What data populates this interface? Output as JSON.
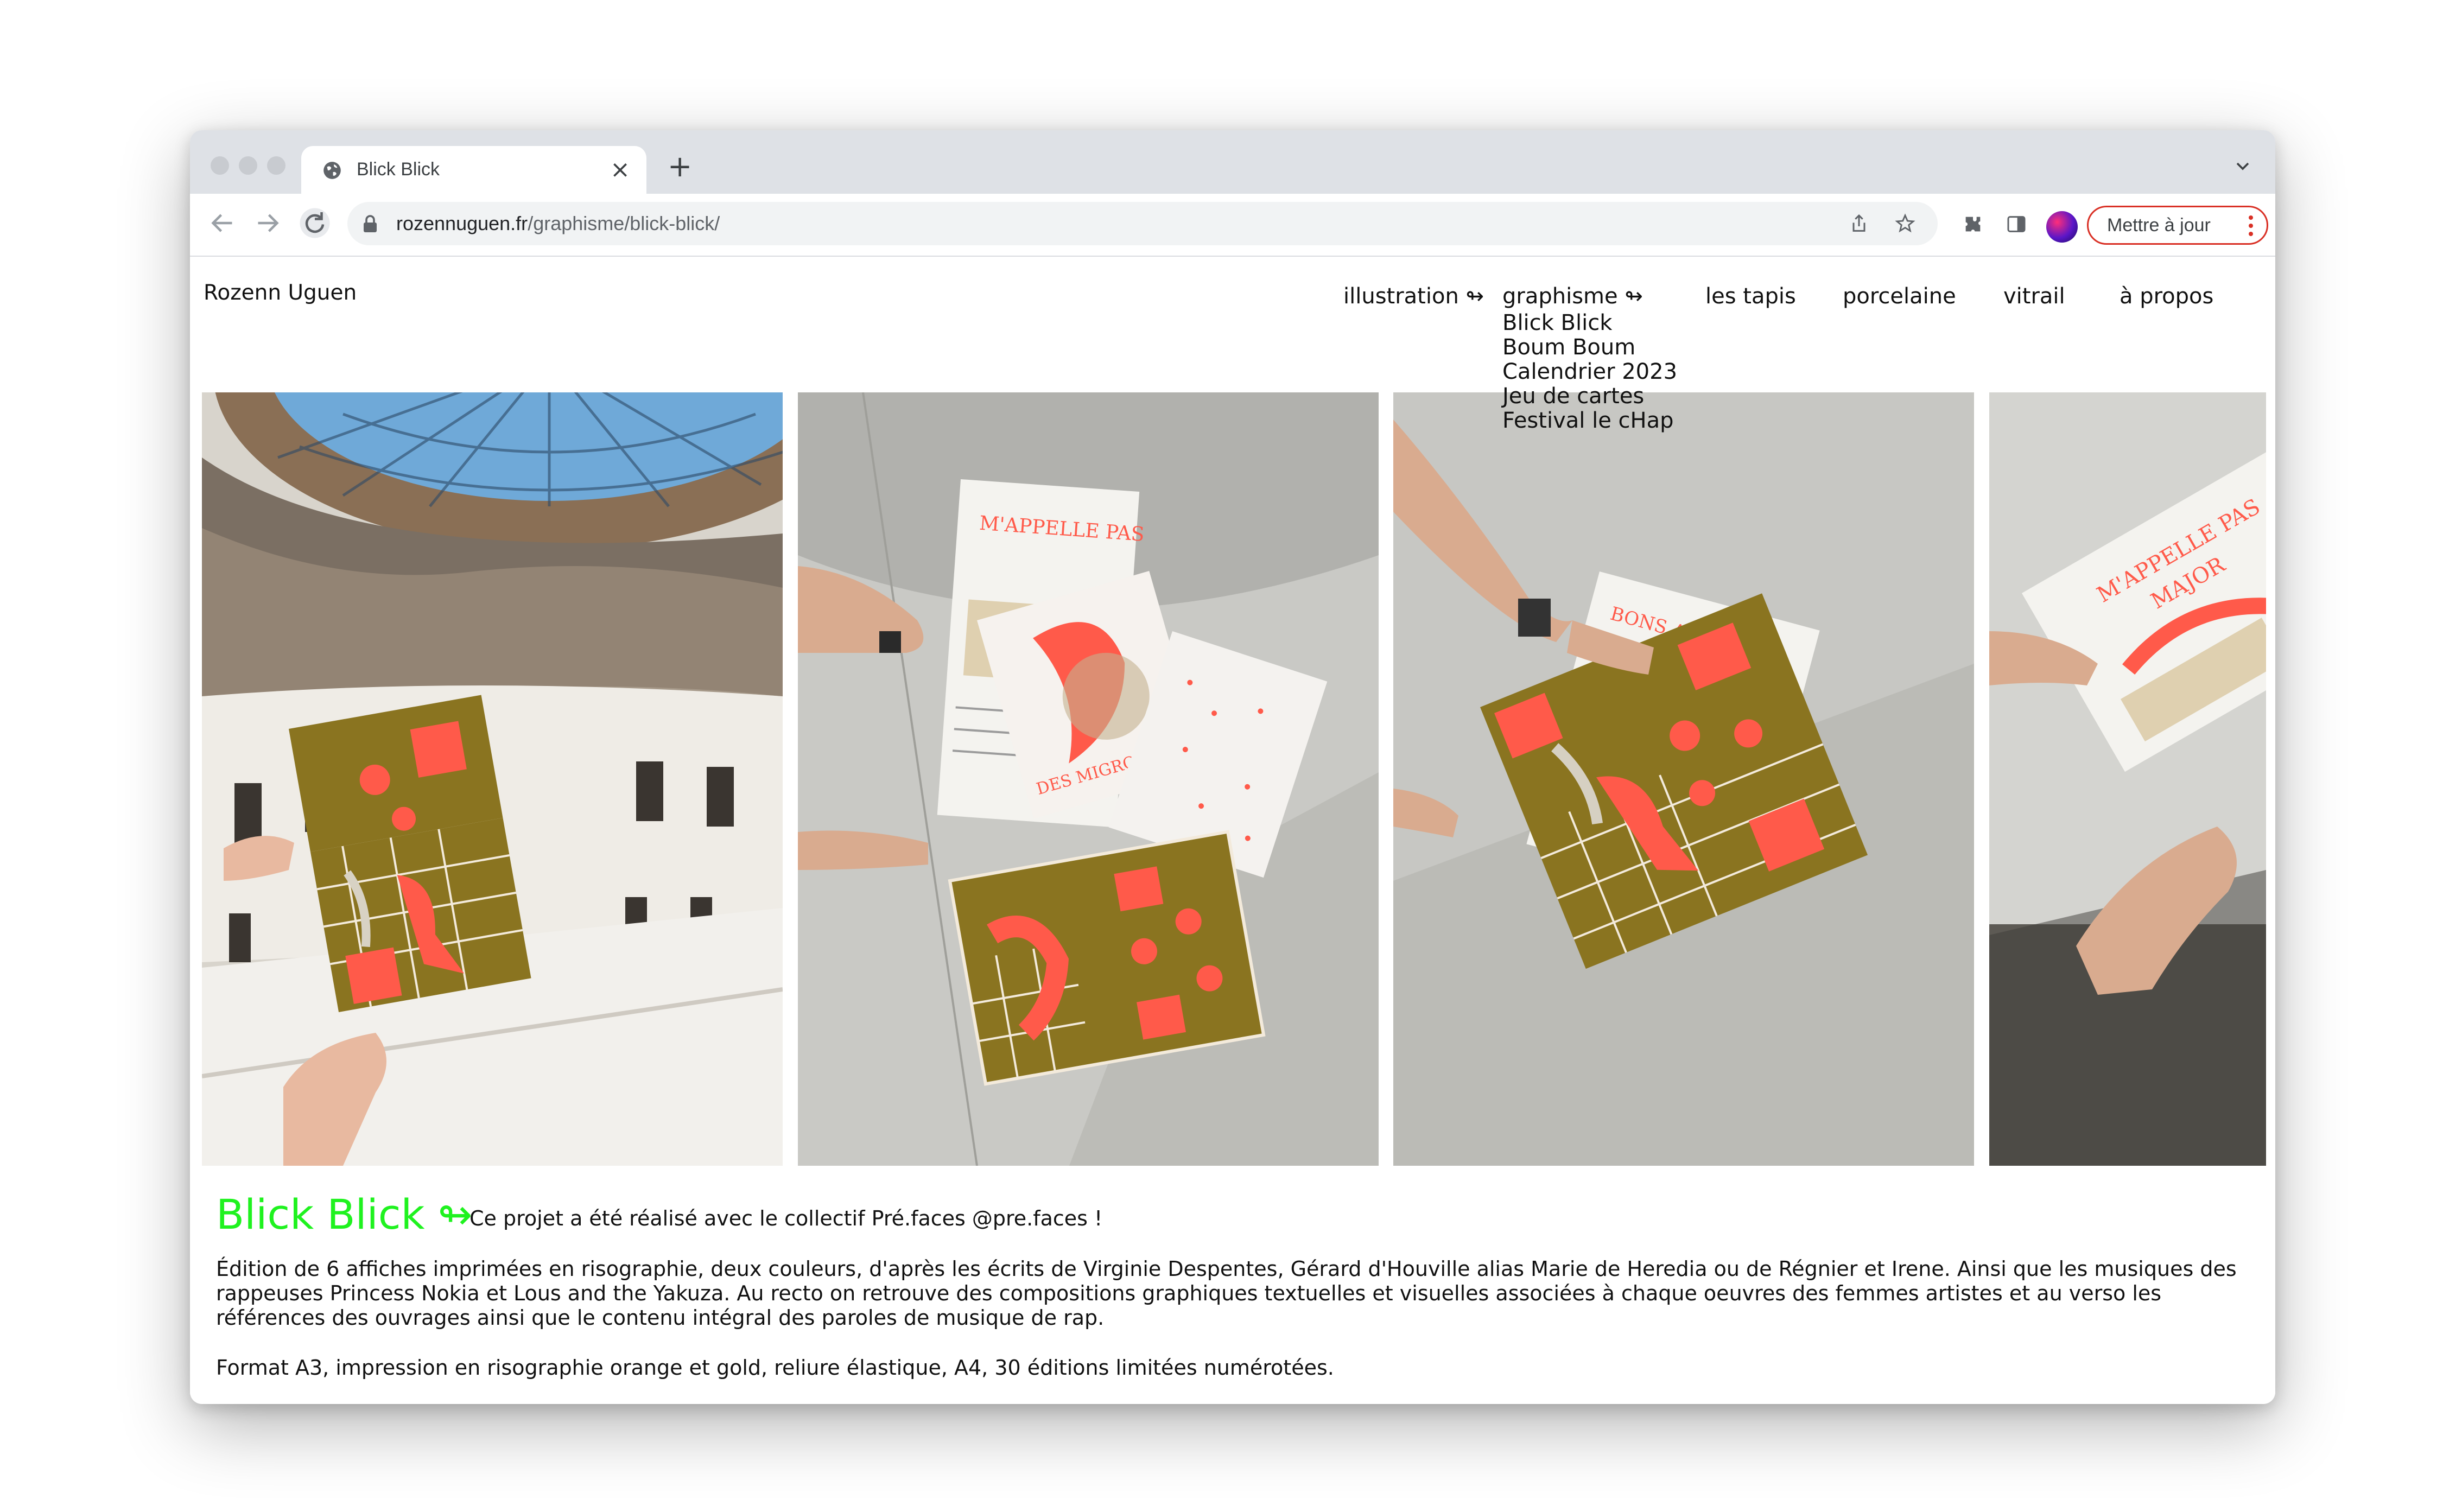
{
  "browser": {
    "tab_title": "Blick Blick",
    "url_domain": "rozennuguen.fr",
    "url_path": "/graphisme/blick-blick/",
    "update_label": "Mettre à jour"
  },
  "site": {
    "name": "Rozenn Uguen",
    "nav": [
      {
        "label": "illustration ↬"
      },
      {
        "label": "graphisme ↬"
      },
      {
        "label": "les tapis"
      },
      {
        "label": "porcelaine"
      },
      {
        "label": "vitrail"
      },
      {
        "label": "à propos"
      }
    ],
    "submenu": [
      "Blick Blick",
      "Boum Boum",
      "Calendrier 2023",
      "Jeu de cartes",
      "Festival le cHap"
    ]
  },
  "project": {
    "title": "Blick Blick ↬",
    "note": "Ce projet a été réalisé avec le collectif Pré.faces @pre.faces !",
    "description": "Édition de 6 affiches imprimées en risographie, deux couleurs, d'après les écrits de Virginie Despentes, Gérard d'Houville alias Marie de Heredia ou de Régnier et Irene. Ainsi que les musiques des rappeuses Princess Nokia et Lous and the Yakuza. Au recto on retrouve des compositions graphiques textuelles et visuelles associées à chaque oeuvres des femmes artistes et au verso les références des ouvrages ainsi que le contenu intégral des paroles de musique de rap.",
    "format": "Format A3, impression en risographie orange et gold, reliure élastique, A4, 30 éditions limitées numérotées."
  },
  "colors": {
    "accent_green": "#1ff21f",
    "riso_orange": "#ff5a4a",
    "riso_gold": "#8a7420",
    "update_red": "#d93025"
  },
  "icons": [
    "back-arrow-icon",
    "forward-arrow-icon",
    "reload-icon",
    "lock-icon",
    "share-icon",
    "star-icon",
    "extensions-icon",
    "sidepanel-icon",
    "globe-icon",
    "close-icon",
    "plus-icon",
    "chevron-down-icon",
    "kebab-menu-icon"
  ]
}
